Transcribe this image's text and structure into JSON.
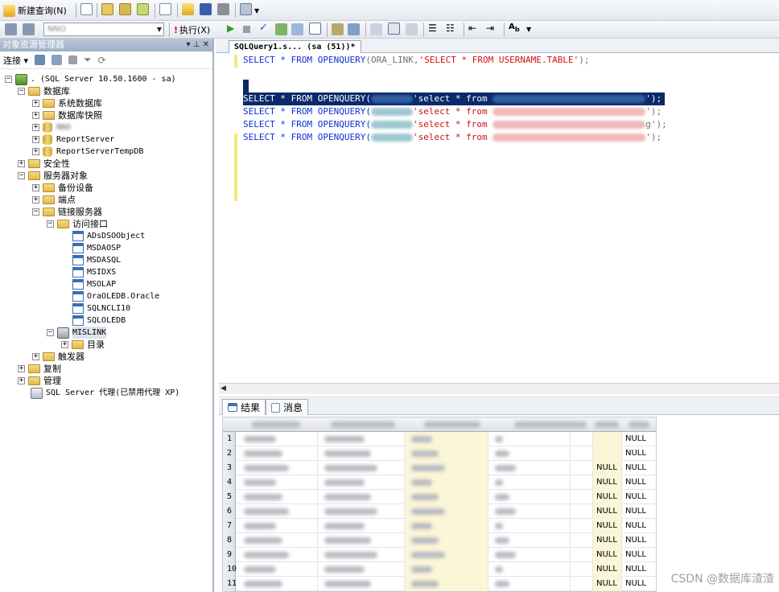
{
  "toolbar1": {
    "new_query_label": "新建查询(N)"
  },
  "toolbar2": {
    "database_value": "NNO",
    "execute_label": "执行(X)"
  },
  "object_explorer": {
    "title": "对象资源管理器",
    "connect_label": "连接",
    "server_label": ". (SQL Server 10.50.1600 - sa)",
    "nodes": {
      "databases": "数据库",
      "system_databases": "系统数据库",
      "db_snapshots": "数据库快照",
      "db_blurred": "NNO",
      "report_server": "ReportServer",
      "report_server_temp": "ReportServerTempDB",
      "security": "安全性",
      "server_objects": "服务器对象",
      "backup_devices": "备份设备",
      "endpoints": "端点",
      "linked_servers": "链接服务器",
      "providers": "访问接口",
      "provider_items": [
        "ADsDSOObject",
        "MSDAOSP",
        "MSDASQL",
        "MSIDXS",
        "MSOLAP",
        "OraOLEDB.Oracle",
        "SQLNCLI10",
        "SQLOLEDB"
      ],
      "mislink": "MISLINK",
      "catalogs": "目录",
      "triggers": "触发器",
      "replication": "复制",
      "management": "管理",
      "agent": "SQL Server 代理(已禁用代理 XP)"
    }
  },
  "query_tab": {
    "label": "SQLQuery1.s...  (sa (51))*"
  },
  "editor": {
    "line1": {
      "kw1": "SELECT * FROM ",
      "fn": "OPENQUERY",
      "p1": "(ORA_LINK,",
      "str": "'SELECT * FROM USERNAME.TABLE'",
      "end": ");"
    },
    "lines": [
      {
        "kw": "SELECT * FROM ",
        "fn": "OPENQUERY(",
        "s": "'select * from ",
        "end": "');"
      },
      {
        "kw": "SELECT * FROM ",
        "fn": "OPENQUERY(",
        "s": "'select * from ",
        "end": "');"
      },
      {
        "kw": "SELECT * FROM ",
        "fn": "OPENQUERY(",
        "s": "'select * from ",
        "end": "g');"
      },
      {
        "kw": "SELECT * FROM ",
        "fn": "OPENQUERY(",
        "s": "'select * from ",
        "end": "');"
      }
    ]
  },
  "results": {
    "tab_results": "结果",
    "tab_messages": "消息",
    "row_numbers": [
      "1",
      "2",
      "3",
      "4",
      "5",
      "6",
      "7",
      "8",
      "9",
      "10",
      "11"
    ],
    "col7": [
      "",
      "",
      "NULL",
      "NULL",
      "NULL",
      "NULL",
      "NULL",
      "NULL",
      "NULL",
      "NULL",
      "NULL"
    ],
    "col8": [
      "NULL",
      "NULL",
      "NULL",
      "NULL",
      "NULL",
      "NULL",
      "NULL",
      "NULL",
      "NULL",
      "NULL",
      "NULL"
    ]
  },
  "watermark": "CSDN @数据库渣渣"
}
